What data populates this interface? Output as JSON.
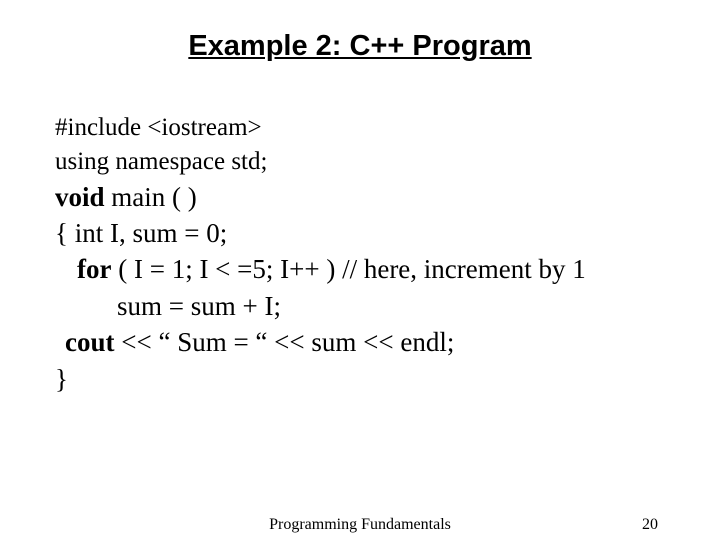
{
  "title": "Example 2: C++ Program",
  "code": {
    "line1": "#include <iostream>",
    "line2": "using namespace std;",
    "line3_bold": "void",
    "line3_rest": " main ( )",
    "line4": "{ int I, sum = 0;",
    "line5_for": "for",
    "line5_rest": " ( I = 1; I < =5; I++ )    // here, increment by 1",
    "line6": "sum = sum + I;",
    "line7_cout": "cout",
    "line7_rest": " << “ Sum = “ <<  sum << endl;",
    "line8": "}"
  },
  "footer": {
    "center": "Programming Fundamentals",
    "page": "20"
  }
}
